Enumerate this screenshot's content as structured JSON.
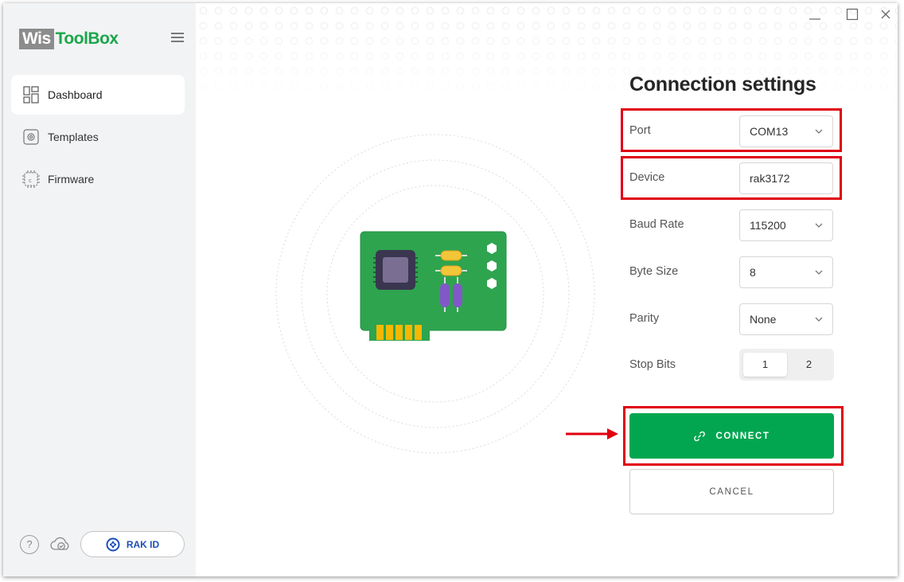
{
  "app": {
    "logo_part1": "Wis",
    "logo_part2": "ToolBox"
  },
  "sidebar": {
    "items": [
      {
        "label": "Dashboard",
        "icon": "dashboard-icon",
        "active": true
      },
      {
        "label": "Templates",
        "icon": "templates-icon",
        "active": false
      },
      {
        "label": "Firmware",
        "icon": "chip-icon",
        "active": false
      }
    ],
    "help_glyph": "?",
    "rak_id_label": "RAK ID"
  },
  "connection": {
    "title": "Connection settings",
    "port": {
      "label": "Port",
      "value": "COM13"
    },
    "device": {
      "label": "Device",
      "value": "rak3172"
    },
    "baud_rate": {
      "label": "Baud Rate",
      "value": "115200"
    },
    "byte_size": {
      "label": "Byte Size",
      "value": "8"
    },
    "parity": {
      "label": "Parity",
      "value": "None"
    },
    "stop_bits": {
      "label": "Stop Bits",
      "options": [
        "1",
        "2"
      ],
      "selected": "1"
    },
    "connect_label": "CONNECT",
    "cancel_label": "CANCEL"
  },
  "colors": {
    "accent_green": "#03a650",
    "highlight_red": "#e0000f",
    "sidebar_bg": "#f2f3f4"
  }
}
